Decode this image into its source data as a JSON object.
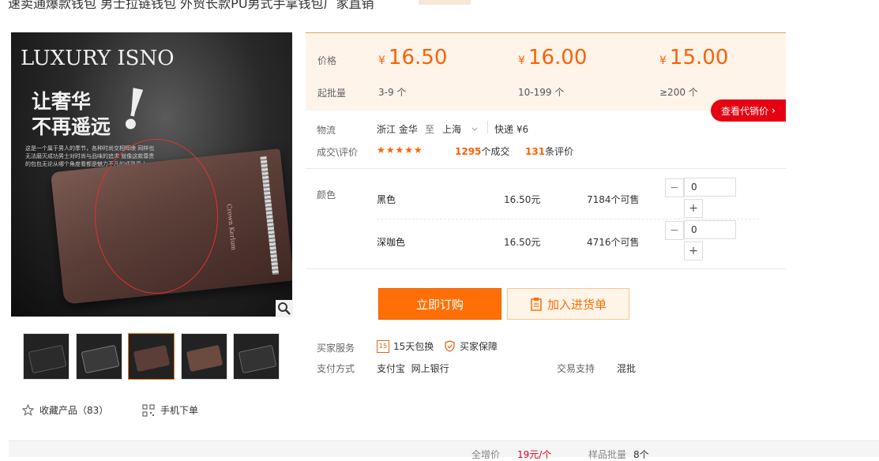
{
  "product": {
    "title_clipped": "速卖通爆款钱包 男士拉链钱包 外贸长款PU男式手拿钱包厂家直销",
    "tag": "",
    "image_brand_line1": "LUXURY ISNO",
    "image_cn_line1": "让奢华",
    "image_cn_line2": "不再遥远",
    "image_exclaim": "!",
    "image_small_text": "这是一个属于男人的季节，各种时尚交相辉映 同样也无法磨灭成功男士对时尚与品味的追求 就像这款尊贵的包包无论从哪个角度看都是魅力不凡的成熟男人。",
    "wallet_logo": "Crown Kerlum"
  },
  "icons": {
    "zoom": "magnifier-icon",
    "collect": "star-outline-icon",
    "mobile": "qrcode-icon",
    "freeship": "package-icon",
    "guarantee": "shield-icon",
    "cart": "clipboard-icon"
  },
  "actions": {
    "collect_label": "收藏产品（83）",
    "mobile_label": "手机下单",
    "agent_price": "查看代销价",
    "agent_arrow": "›",
    "order_now": "立即订购",
    "add_cart": "加入进货单"
  },
  "pricing": {
    "price_label": "价格",
    "moq_label": "起批量",
    "currency": "¥",
    "tiers": [
      {
        "price": "16.50",
        "range": "3-9 个"
      },
      {
        "price": "16.00",
        "range": "10-199 个"
      },
      {
        "price": "15.00",
        "range": "≥200 个"
      }
    ]
  },
  "logistics": {
    "label": "物流",
    "from": "浙江 金华",
    "to_word": "至",
    "to": "上海",
    "method": "快递 ¥6"
  },
  "stats": {
    "label": "成交\\评价",
    "stars": "★★★★★",
    "sales_count": "1295",
    "sales_unit": "个成交",
    "review_count": "131",
    "review_unit": "条评价"
  },
  "colors": {
    "label": "颜色",
    "items": [
      {
        "name": "黑色",
        "price": "16.50元",
        "stock": "7184个可售",
        "qty": "0"
      },
      {
        "name": "深咖色",
        "price": "16.50元",
        "stock": "4716个可售",
        "qty": "0"
      }
    ],
    "minus": "−",
    "plus": "+"
  },
  "services": {
    "label": "买家服务",
    "freeship": "15天包换",
    "freeship_icon_char": "15",
    "guarantee": "买家保障",
    "pay_label": "支付方式",
    "pay_methods": "支付宝  网上银行",
    "trade_label": "交易支持",
    "trade_value": "混批"
  },
  "bottom": {
    "text1": "全增价",
    "text2": "19元/个",
    "text3": "样品批量",
    "text4": "8个"
  },
  "palette": {
    "accent": "#ff6000",
    "red": "#e60012",
    "priceBg": "#fff4ea"
  }
}
